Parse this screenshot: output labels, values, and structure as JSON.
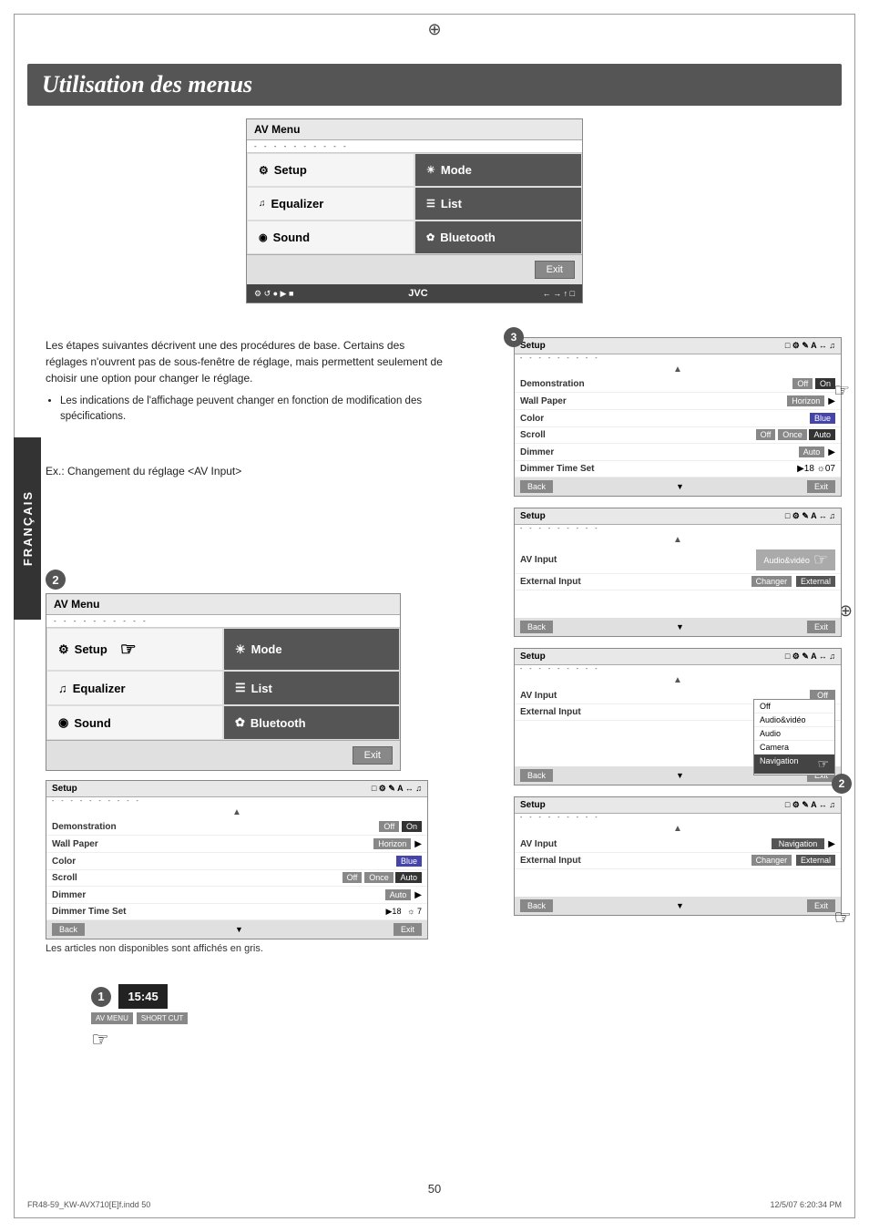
{
  "page": {
    "title": "Utilisation des menus",
    "page_number": "50",
    "footer_left": "FR48-59_KW-AVX710[E]f.indd  50",
    "footer_right": "12/5/07  6:20:34 PM"
  },
  "sidebar": {
    "label": "FRANÇAIS"
  },
  "av_menu_top": {
    "header": "AV Menu",
    "dots": "- - - - - - - - - -",
    "items": [
      {
        "icon": "⚙",
        "label": "Setup"
      },
      {
        "icon": "☀",
        "label": "Mode"
      },
      {
        "icon": "♫",
        "label": "Equalizer"
      },
      {
        "icon": "☰",
        "label": "List"
      },
      {
        "icon": "◉",
        "label": "Sound"
      },
      {
        "icon": "✿",
        "label": "Bluetooth"
      }
    ],
    "exit_label": "Exit"
  },
  "french_text": {
    "para1": "Les étapes suivantes décrivent une des procédures de base. Certains des réglages n'ouvrent pas de sous-fenêtre de réglage, mais permettent seulement de choisir une option pour changer le réglage.",
    "bullet": "Les indications de l'affichage peuvent changer en fonction de modification des spécifications.",
    "example": "Ex.: Changement du réglage <AV Input>"
  },
  "step1": {
    "number": "1",
    "time": "15:45",
    "button1": "AV MENU",
    "button2": "SHORT CUT"
  },
  "step2": {
    "number": "2",
    "av_menu_header": "AV Menu",
    "items": [
      {
        "icon": "⚙",
        "label": "Setup"
      },
      {
        "icon": "☀",
        "label": "Mode"
      },
      {
        "icon": "♫",
        "label": "Equalizer"
      },
      {
        "icon": "☰",
        "label": "List"
      },
      {
        "icon": "◉",
        "label": "Sound"
      },
      {
        "icon": "✿",
        "label": "Bluetooth"
      }
    ],
    "exit_label": "Exit"
  },
  "setup_screen1_left": {
    "header": "Setup",
    "rows": [
      {
        "label": "Demonstration",
        "values": [
          "Off",
          "On"
        ]
      },
      {
        "label": "Wall Paper",
        "values": [
          "Horizon"
        ],
        "arrow": true
      },
      {
        "label": "Color",
        "values": [
          "Blue"
        ]
      },
      {
        "label": "Scroll",
        "values": [
          "Off",
          "Once",
          "Auto"
        ]
      },
      {
        "label": "Dimmer",
        "values": [
          "Auto"
        ],
        "arrow": true
      },
      {
        "label": "Dimmer Time Set",
        "values": [
          "▶18",
          "☼07"
        ]
      }
    ],
    "back_label": "Back",
    "exit_label": "Exit",
    "non_dispo": "Les articles non disponibles sont affichés en gris."
  },
  "right_screens": {
    "screen3": {
      "step": "3",
      "header": "Setup",
      "rows": [
        {
          "label": "Demonstration",
          "values": [
            "Off",
            "On"
          ],
          "on_highlight": true
        },
        {
          "label": "Wall Paper",
          "values": [
            "Horizon"
          ],
          "arrow": true
        },
        {
          "label": "Color",
          "values": [
            "Blue"
          ]
        },
        {
          "label": "Scroll",
          "values": [
            "Off",
            "Once",
            "Auto"
          ],
          "auto_dark": true
        },
        {
          "label": "Dimmer",
          "values": [
            "Auto"
          ],
          "arrow": true
        },
        {
          "label": "Dimmer Time Set",
          "values": [
            "▶18",
            "☼07"
          ]
        }
      ],
      "back_label": "Back",
      "exit_label": "Exit"
    },
    "screen_av_input1": {
      "header": "Setup",
      "rows": [
        {
          "label": "AV Input",
          "values": [
            "Audio&vidéo"
          ],
          "arrow": true,
          "highlight": true
        },
        {
          "label": "External Input",
          "values": [
            "Changer",
            "External"
          ]
        }
      ],
      "back_label": "Back",
      "exit_label": "Exit"
    },
    "screen_av_input2": {
      "header": "Setup",
      "step_num": "2",
      "dropdown": [
        "Off",
        "Audio&vidéo",
        "Audio",
        "Camera",
        "Navigation"
      ],
      "selected": "Navigation",
      "rows": [
        {
          "label": "AV Input",
          "values": [
            "Off"
          ]
        },
        {
          "label": "External Input",
          "values": [
            ""
          ]
        }
      ],
      "back_label": "Back",
      "exit_label": "Exit"
    },
    "screen_av_input3": {
      "header": "Setup",
      "rows": [
        {
          "label": "AV Input",
          "values": [
            "Navigation"
          ],
          "arrow": true
        },
        {
          "label": "External Input",
          "values": [
            "Changer",
            "External"
          ]
        }
      ],
      "back_label": "Back",
      "exit_label": "Exit"
    }
  }
}
